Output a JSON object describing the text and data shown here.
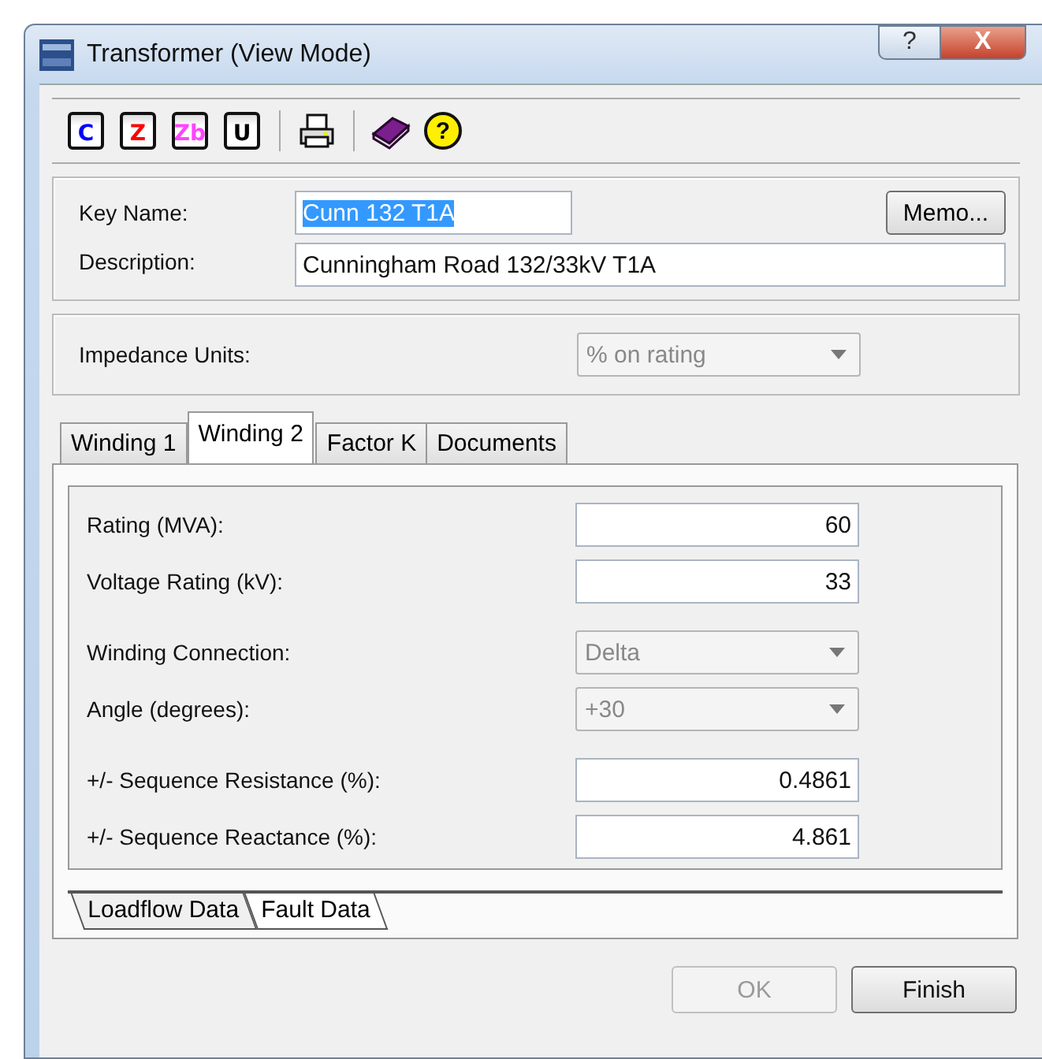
{
  "window": {
    "title": "Transformer (View Mode)"
  },
  "title_buttons": [
    {
      "kind": "help",
      "label": "?"
    },
    {
      "kind": "close",
      "label": "X"
    }
  ],
  "toolbar": [
    {
      "kind": "letter",
      "label": "C",
      "color": "#0000ff"
    },
    {
      "kind": "letter",
      "label": "Z",
      "color": "#ff0000"
    },
    {
      "kind": "letter",
      "label": "Zb",
      "color": "#ff44ff"
    },
    {
      "kind": "letter",
      "label": "U",
      "color": "#000000"
    },
    {
      "kind": "separator"
    },
    {
      "kind": "print"
    },
    {
      "kind": "separator"
    },
    {
      "kind": "book"
    },
    {
      "kind": "help",
      "label": "?"
    }
  ],
  "identity": {
    "key_name": {
      "label": "Key Name:",
      "value": "Cunn 132 T1A",
      "selected": true
    },
    "description": {
      "label": "Description:",
      "value": "Cunningham Road 132/33kV T1A"
    },
    "memo_button": "Memo..."
  },
  "impedance_units": {
    "label": "Impedance Units:",
    "value": "% on rating",
    "disabled": true
  },
  "tabs": [
    {
      "label": "Winding 1",
      "selected": false
    },
    {
      "label": "Winding 2",
      "selected": true
    },
    {
      "label": "Factor K",
      "selected": false
    },
    {
      "label": "Documents",
      "selected": false
    }
  ],
  "field_groups": [
    {
      "fields": [
        {
          "kind": "text",
          "label": "Rating (MVA):",
          "value": "60"
        },
        {
          "kind": "text",
          "label": "Voltage Rating (kV):",
          "value": "33"
        }
      ]
    },
    {
      "fields": [
        {
          "kind": "select",
          "label": "Winding Connection:",
          "value": "Delta",
          "disabled": true
        },
        {
          "kind": "select",
          "label": "Angle (degrees):",
          "value": "+30",
          "disabled": true
        }
      ]
    },
    {
      "fields": [
        {
          "kind": "text",
          "label": "+/- Sequence Resistance (%):",
          "value": "0.4861"
        },
        {
          "kind": "text",
          "label": "+/- Sequence Reactance (%):",
          "value": "4.861"
        }
      ]
    }
  ],
  "subtabs": [
    {
      "label": "Loadflow Data",
      "selected": true
    },
    {
      "label": "Fault Data",
      "selected": false
    }
  ],
  "buttons": [
    {
      "label": "OK",
      "disabled": true
    },
    {
      "label": "Finish",
      "disabled": false
    }
  ]
}
